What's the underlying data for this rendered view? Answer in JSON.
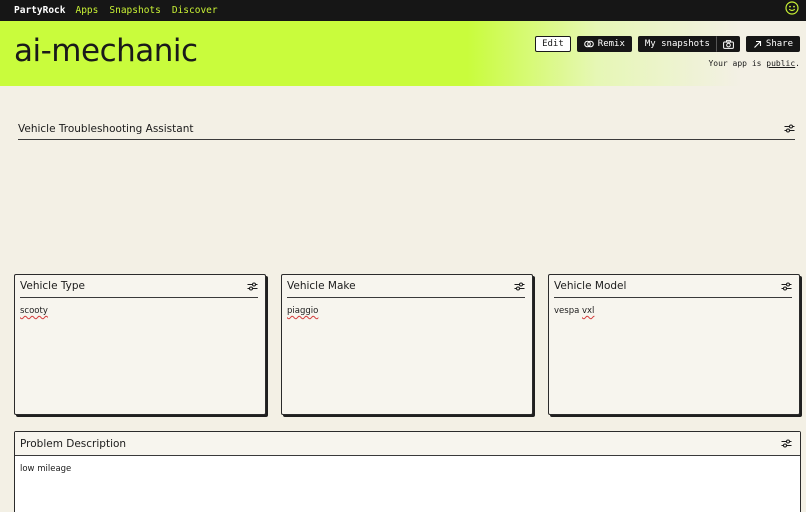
{
  "topbar": {
    "brand": "PartyRock",
    "nav": [
      "Apps",
      "Snapshots",
      "Discover"
    ],
    "profile_icon": "smiley-icon"
  },
  "app": {
    "title": "ai-mechanic",
    "visibility_prefix": "Your app is ",
    "visibility_link": "public",
    "visibility_suffix": "."
  },
  "actions": {
    "edit": "Edit",
    "remix": "Remix",
    "my_snapshots": "My snapshots",
    "share": "Share"
  },
  "sections": {
    "assistant_title": "Vehicle Troubleshooting Assistant"
  },
  "widgets": {
    "vehicle_type": {
      "label": "Vehicle Type",
      "value": "scooty"
    },
    "vehicle_make": {
      "label": "Vehicle Make",
      "value": "piaggio"
    },
    "vehicle_model": {
      "label": "Vehicle Model",
      "value_plain": "vespa ",
      "value_flag": "vxl"
    },
    "problem": {
      "label": "Problem Description",
      "value": "low mileage"
    }
  },
  "colors": {
    "accent": "#c9fc3c",
    "topbar": "#161616",
    "nav_link": "#c8f135",
    "background": "#f3f0e5"
  }
}
